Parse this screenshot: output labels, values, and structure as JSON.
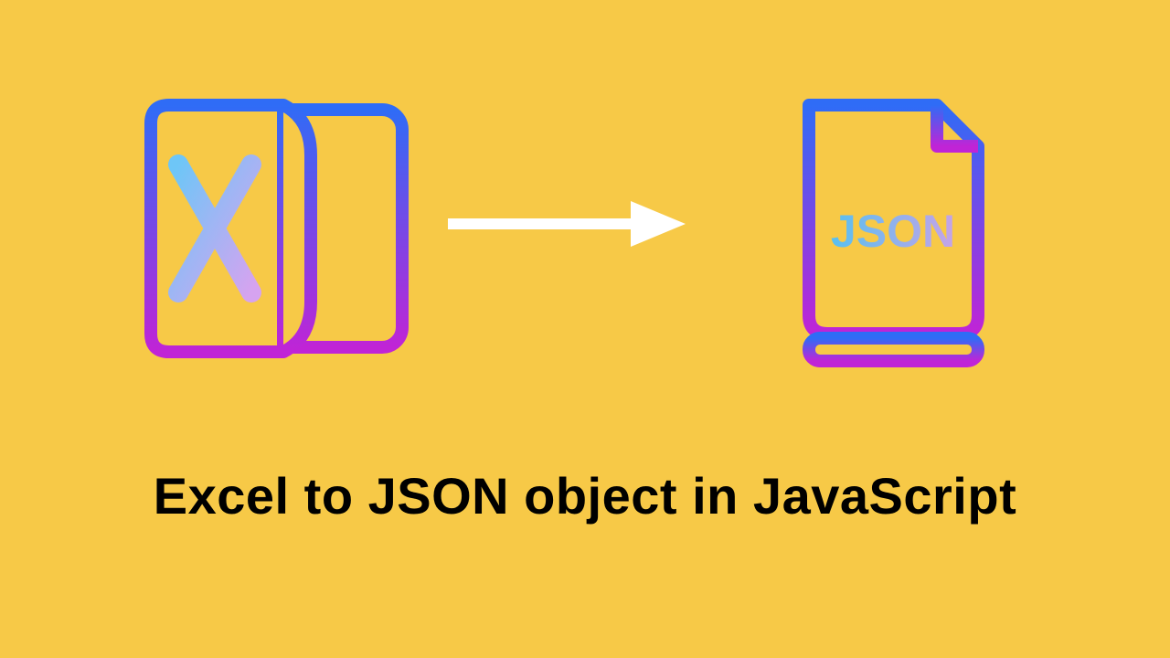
{
  "heading": "Excel to JSON object in JavaScript",
  "icons": {
    "excel": "excel-file-icon",
    "arrow": "arrow-right-icon",
    "json": "json-file-icon",
    "json_label": "JSON"
  }
}
